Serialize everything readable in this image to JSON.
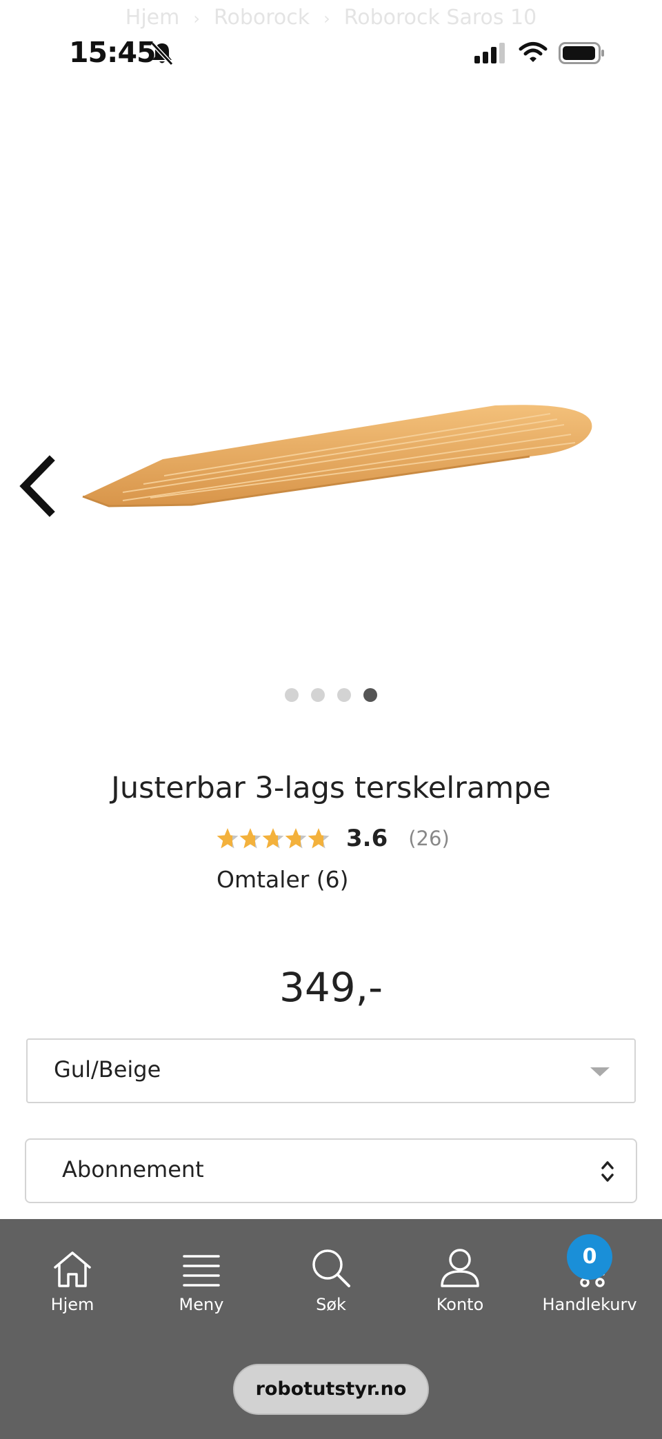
{
  "breadcrumb": {
    "items": [
      "Hjem",
      "Roborock",
      "Roborock Saros 10"
    ],
    "separator": "›"
  },
  "status_bar": {
    "time": "15:45",
    "icons": [
      "bell-slash-icon",
      "signal-icon",
      "wifi-icon",
      "battery-icon"
    ]
  },
  "gallery": {
    "image_count": 4,
    "active_index": 3,
    "image": "ramp-image",
    "prev_icon": "chevron-left-icon"
  },
  "product": {
    "title": "Justerbar 3-lags terskelrampe",
    "rating": "3.6",
    "rating_fraction": 0.72,
    "rating_count": "(26)",
    "reviews_label": "Omtaler (6)",
    "price": "349,-"
  },
  "options": {
    "color_select_value": "Gul/Beige",
    "subscription_select_value": "Abonnement"
  },
  "bottom_nav": {
    "items": [
      {
        "label": "Hjem",
        "icon": "home-icon"
      },
      {
        "label": "Meny",
        "icon": "menu-icon"
      },
      {
        "label": "Søk",
        "icon": "search-icon"
      },
      {
        "label": "Konto",
        "icon": "account-icon"
      },
      {
        "label": "Handlekurv",
        "icon": "cart-icon"
      }
    ],
    "cart_count": "0"
  },
  "browser": {
    "url": "robotutstyr.no"
  },
  "colors": {
    "star": "#f3b13c",
    "star_empty": "#c4c4c4",
    "badge": "#1a8fd8",
    "nav_bg": "#616161",
    "ramp": "#e6a85c"
  }
}
